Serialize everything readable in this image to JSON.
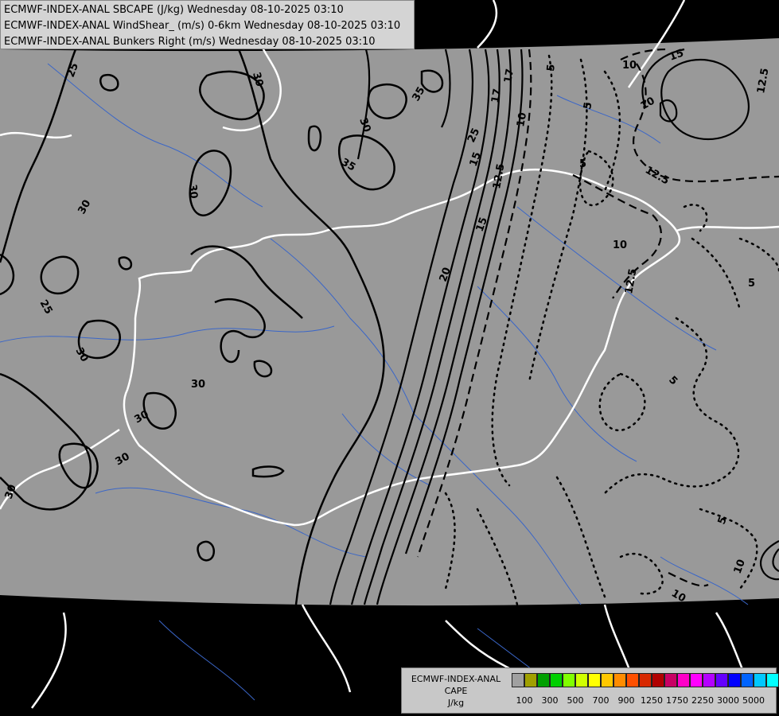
{
  "header": {
    "lines": [
      "ECMWF-INDEX-ANAL SBCAPE (J/kg) Wednesday 08-10-2025 03:10",
      "ECMWF-INDEX-ANAL WindShear_ (m/s) 0-6km Wednesday 08-10-2025 03:10",
      "ECMWF-INDEX-ANAL Bunkers Right (m/s) Wednesday 08-10-2025 03:10"
    ]
  },
  "map": {
    "background_color": "#999999",
    "outside_color": "#000000",
    "border_color": "#ffffff",
    "river_color": "#3a66c8",
    "contour_color": "#000000",
    "contour_labels": [
      "25",
      "30",
      "30",
      "30",
      "35",
      "35",
      "30",
      "30",
      "25",
      "30",
      "30",
      "30",
      "30",
      "20",
      "25",
      "15",
      "12.5",
      "10",
      "5",
      "15",
      "12.5",
      "10",
      "5",
      "17",
      "12.5",
      "10",
      "15",
      "17",
      "5",
      "10",
      "5",
      "5",
      "12.5",
      "10",
      "5",
      "10"
    ]
  },
  "legend": {
    "title_lines": [
      "ECMWF-INDEX-ANAL",
      "CAPE",
      "J/kg"
    ],
    "colors": [
      "#a0a0a0",
      "#a0a000",
      "#00a000",
      "#00d000",
      "#80ff00",
      "#d0ff00",
      "#ffff00",
      "#ffc800",
      "#ff8c00",
      "#ff5000",
      "#d82800",
      "#b00000",
      "#c80064",
      "#ff00c8",
      "#ff00ff",
      "#b400ff",
      "#6400ff",
      "#0000ff",
      "#0064ff",
      "#00c8ff",
      "#00ffff",
      "#80ffff",
      "#ffffff"
    ],
    "tick_labels": [
      "100",
      "300",
      "500",
      "700",
      "900",
      "1250",
      "1750",
      "2250",
      "3000",
      "5000"
    ]
  }
}
